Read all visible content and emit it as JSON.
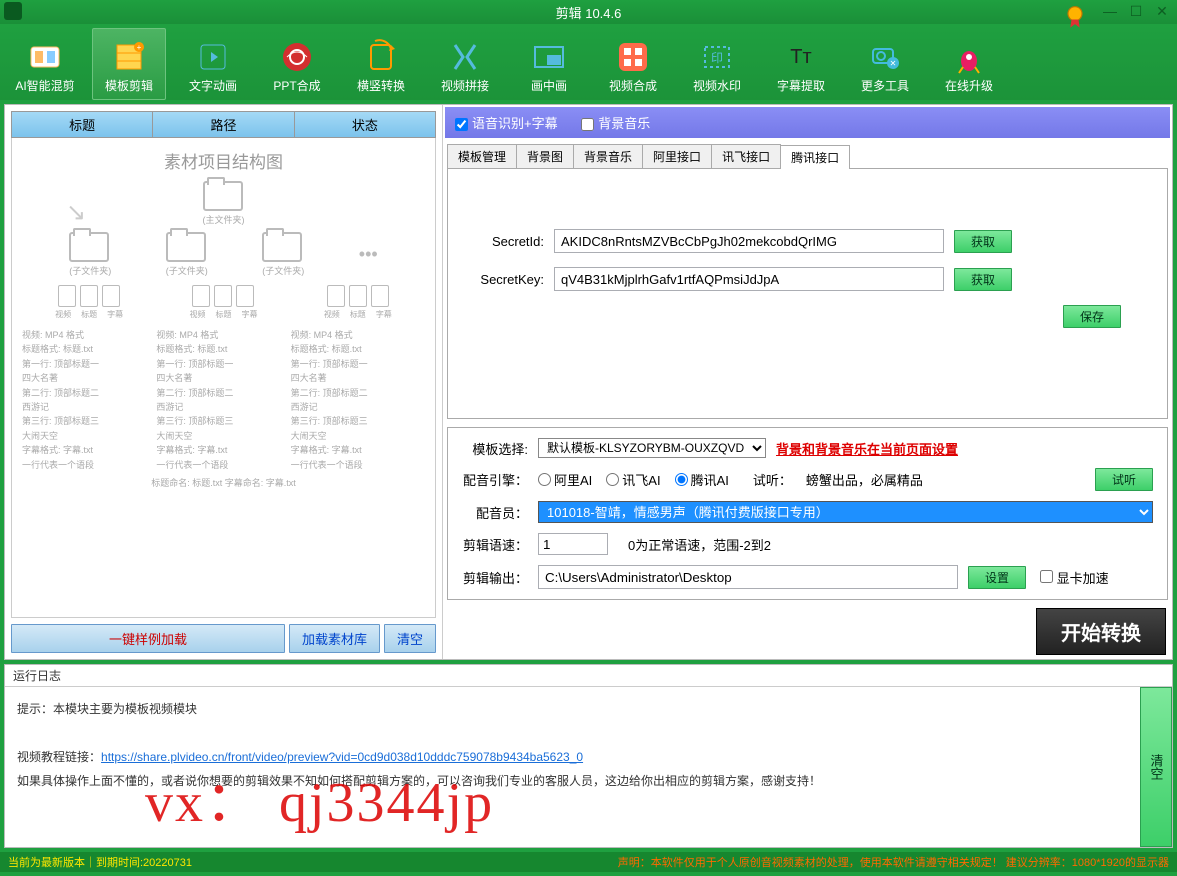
{
  "title": "剪辑 10.4.6",
  "toolbar": [
    {
      "label": "AI智能混剪",
      "icon": "ai"
    },
    {
      "label": "模板剪辑",
      "icon": "template",
      "active": true
    },
    {
      "label": "文字动画",
      "icon": "text"
    },
    {
      "label": "PPT合成",
      "icon": "ppt"
    },
    {
      "label": "横竖转换",
      "icon": "rotate"
    },
    {
      "label": "视频拼接",
      "icon": "merge"
    },
    {
      "label": "画中画",
      "icon": "pip"
    },
    {
      "label": "视频合成",
      "icon": "compose"
    },
    {
      "label": "视频水印",
      "icon": "watermark"
    },
    {
      "label": "字幕提取",
      "icon": "subtitle"
    },
    {
      "label": "更多工具",
      "icon": "more"
    },
    {
      "label": "在线升级",
      "icon": "upgrade"
    }
  ],
  "left": {
    "headers": [
      "标题",
      "路径",
      "状态"
    ],
    "diagram_title": "素材项目结构图",
    "main_folder": "(主文件夹)",
    "sub_folder": "(子文件夹)",
    "file_labels": [
      "视频",
      "标题",
      "字幕"
    ],
    "line1": "视频: MP4 格式",
    "line2": "标题格式: 标题.txt",
    "line3": "第一行: 顶部标题一",
    "line4": "四大名著",
    "line5": "第二行: 顶部标题二",
    "line6": "西游记",
    "line7": "第三行: 顶部标题三",
    "line8": "大闹天空",
    "line9": "字幕格式: 字幕.txt",
    "line10": "一行代表一个语段",
    "line11": "标题命名: 标题.txt 字幕命名: 字幕.txt",
    "btn_load_example": "一键样例加载",
    "btn_load_lib": "加载素材库",
    "btn_clear": "清空"
  },
  "options": {
    "voice_subtitle": "语音识别+字幕",
    "bg_music": "背景音乐"
  },
  "tabs": [
    "模板管理",
    "背景图",
    "背景音乐",
    "阿里接口",
    "讯飞接口",
    "腾讯接口"
  ],
  "form": {
    "secret_id_label": "SecretId:",
    "secret_id_value": "AKIDC8nRntsMZVBcCbPgJh02mekcobdQrIMG",
    "secret_key_label": "SecretKey:",
    "secret_key_value": "qV4B31kMjplrhGafv1rtfAQPmsiJdJpA",
    "get_btn": "获取",
    "save_btn": "保存"
  },
  "lower": {
    "template_label": "模板选择:",
    "template_value": "默认模板-KLSYZORYBM-OUXZQVD",
    "template_link": "背景和背景音乐在当前页面设置",
    "engine_label": "配音引擎：",
    "engine_ali": "阿里AI",
    "engine_xf": "讯飞AI",
    "engine_tx": "腾讯AI",
    "preview_label": "试听：",
    "preview_text": "螃蟹出品，必属精品",
    "preview_btn": "试听",
    "voice_label": "配音员：",
    "voice_value": "101018-智靖，情感男声（腾讯付费版接口专用）",
    "speed_label": "剪辑语速：",
    "speed_value": "1",
    "speed_hint": "0为正常语速，范围-2到2",
    "output_label": "剪辑输出：",
    "output_value": "C:\\Users\\Administrator\\Desktop",
    "output_btn": "设置",
    "gpu_label": "显卡加速"
  },
  "start_btn": "开始转换",
  "log": {
    "title": "运行日志",
    "tip": "提示：本模块主要为模板视频模块",
    "link_label": "视频教程链接：",
    "link": "https://share.plvideo.cn/front/video/preview?vid=0cd9d038d10dddc759078b9434ba5623_0",
    "hint": "如果具体操作上面不懂的，或者说你想要的剪辑效果不知如何搭配剪辑方案的，可以咨询我们专业的客服人员，这边给你出相应的剪辑方案，感谢支持！",
    "clear": "清空",
    "watermark": "vx： qj3344jp"
  },
  "status": {
    "left": "当前为最新版本｜到期时间:20220731",
    "right": "声明：本软件仅用于个人原创音视频素材的处理，使用本软件请遵守相关规定！  建议分辨率：1080*1920的显示器"
  }
}
